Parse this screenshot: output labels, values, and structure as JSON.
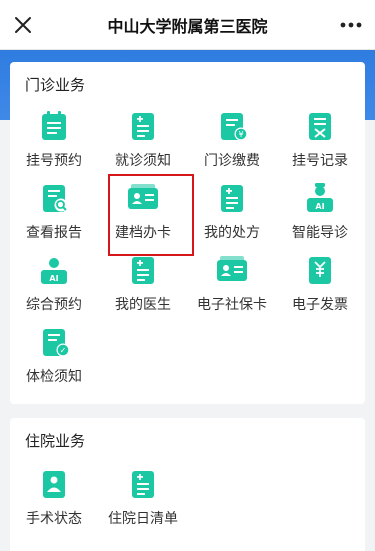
{
  "header": {
    "title": "中山大学附属第三医院",
    "close_icon": "close-icon",
    "more_icon": "more-icon"
  },
  "colors": {
    "brand_blue": "#2f7ce0",
    "icon_green": "#1cc7a4",
    "highlight_red": "#d6161b"
  },
  "outpatient": {
    "title": "门诊业务",
    "items": [
      {
        "label": "挂号预约",
        "icon": "clipboard-list-icon"
      },
      {
        "label": "就诊须知",
        "icon": "notice-plus-icon"
      },
      {
        "label": "门诊缴费",
        "icon": "payment-yen-icon"
      },
      {
        "label": "挂号记录",
        "icon": "record-cross-icon"
      },
      {
        "label": "查看报告",
        "icon": "report-search-icon"
      },
      {
        "label": "建档办卡",
        "icon": "id-card-icon"
      },
      {
        "label": "我的处方",
        "icon": "prescription-plus-icon"
      },
      {
        "label": "智能导诊",
        "icon": "ai-doctor-icon"
      },
      {
        "label": "综合预约",
        "icon": "ai-nurse-icon"
      },
      {
        "label": "我的医生",
        "icon": "doctor-plus-icon"
      },
      {
        "label": "电子社保卡",
        "icon": "social-card-icon"
      },
      {
        "label": "电子发票",
        "icon": "invoice-yen-icon"
      },
      {
        "label": "体检须知",
        "icon": "checkup-doc-icon"
      }
    ]
  },
  "inpatient": {
    "title": "住院业务",
    "items": [
      {
        "label": "手术状态",
        "icon": "surgery-person-icon"
      },
      {
        "label": "住院日清单",
        "icon": "daily-list-icon"
      }
    ]
  }
}
